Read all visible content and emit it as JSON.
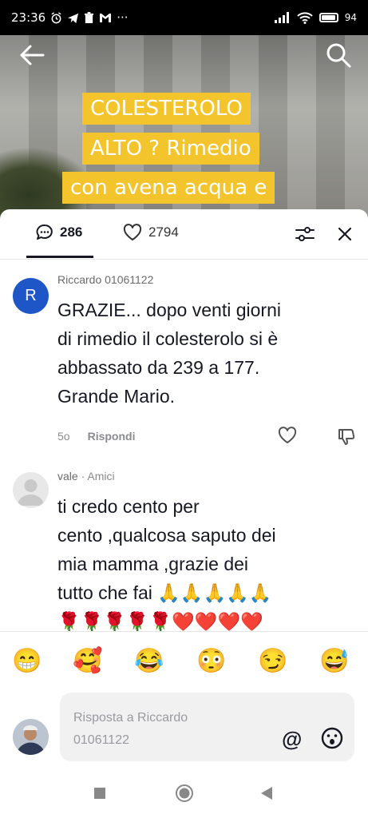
{
  "status_bar": {
    "time": "23:36",
    "battery": "94"
  },
  "video": {
    "overlay_lines": [
      "COLESTEROLO",
      "ALTO ? Rimedio",
      "con avena acqua e"
    ]
  },
  "comments_header": {
    "comment_count": "286",
    "like_count": "2794"
  },
  "comments": [
    {
      "avatar_initial": "R",
      "avatar_color": "#1e56c7",
      "username": "Riccardo 01061122",
      "text_lines": [
        "GRAZIE... dopo venti giorni",
        "di rimedio il colesterolo si è",
        "abbassato da 239 a 177.",
        "Grande Mario."
      ],
      "age": "5o",
      "reply_label": "Rispondi"
    },
    {
      "username": "vale",
      "relation": " · Amici",
      "text_lines": [
        "ti credo cento per",
        "cento ,qualcosa saputo dei",
        "mia mamma ,grazie dei",
        "tutto che fai 🙏🙏🙏🙏🙏"
      ],
      "partial_line": "🌹🌹🌹🌹🌹❤️❤️❤️❤️"
    }
  ],
  "quick_emojis": [
    "😁",
    "🥰",
    "😂",
    "😳",
    "😏",
    "😅"
  ],
  "reply_box": {
    "placeholder_line1": "Risposta a Riccardo",
    "placeholder_line2": "01061122",
    "at_label": "@"
  },
  "icons": {
    "back": "arrow-left-icon",
    "search": "search-icon",
    "comments": "comment-bubble-icon",
    "likes": "heart-outline-icon",
    "filter": "filter-sliders-icon",
    "close": "close-icon",
    "like": "heart-icon",
    "dislike": "thumbs-down-icon",
    "emoji": "emoji-face-icon",
    "nav_recent": "square-icon",
    "nav_home": "circle-icon",
    "nav_back": "triangle-back-icon"
  }
}
